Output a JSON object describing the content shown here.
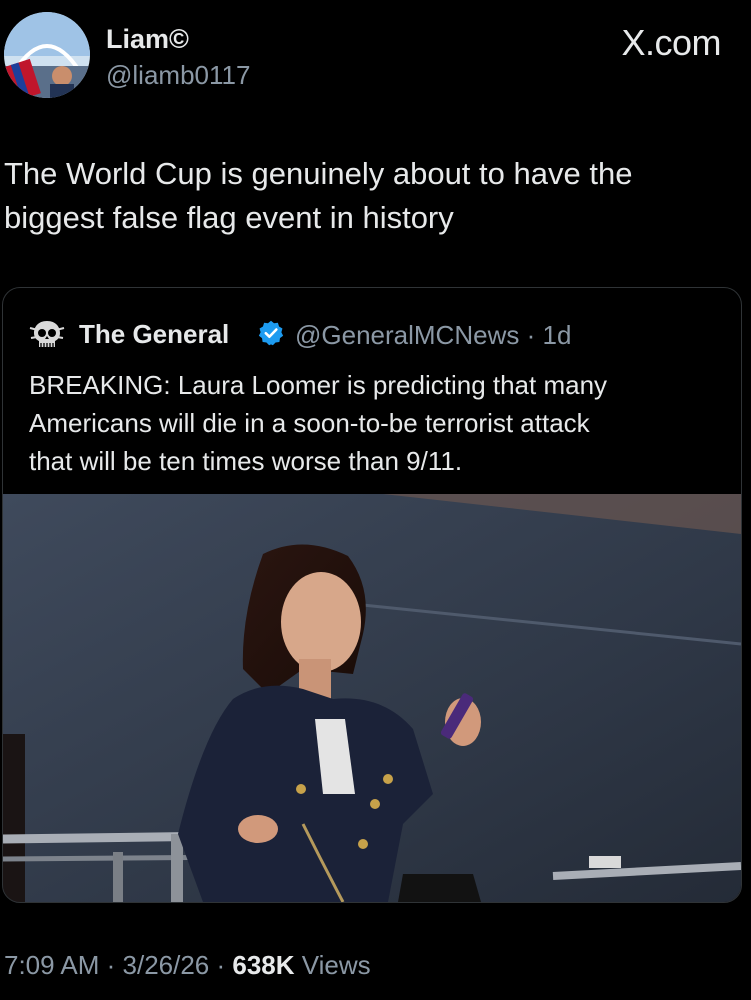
{
  "brand": "X.com",
  "author": {
    "name": "Liam©",
    "handle": "@liamb0117"
  },
  "tweet": {
    "text_line1": "The World Cup is genuinely about to have the",
    "text_line2": "biggest false flag event in history"
  },
  "quoted_tweet": {
    "name": "The General",
    "handle": "@GeneralMCNews",
    "separator": "·",
    "age": "1d",
    "text_line1": "BREAKING: Laura Loomer is predicting that many",
    "text_line2": "Americans will die in a soon-to-be terrorist attack",
    "text_line3": "that will be ten times worse than 9/11."
  },
  "meta": {
    "time": "7:09 AM",
    "sep1": " · ",
    "date": "3/26/26",
    "sep2": " · ",
    "views_count": "638K",
    "views_label": " Views"
  },
  "colors": {
    "background": "#000000",
    "text": "#e7e9ea",
    "secondary": "#8b98a5",
    "border": "#2f3336",
    "verified": "#1d9bf0"
  },
  "icons": {
    "avatar": "avatar",
    "quoted_avatar": "skull-logo-icon",
    "verified": "verified-badge-icon"
  }
}
